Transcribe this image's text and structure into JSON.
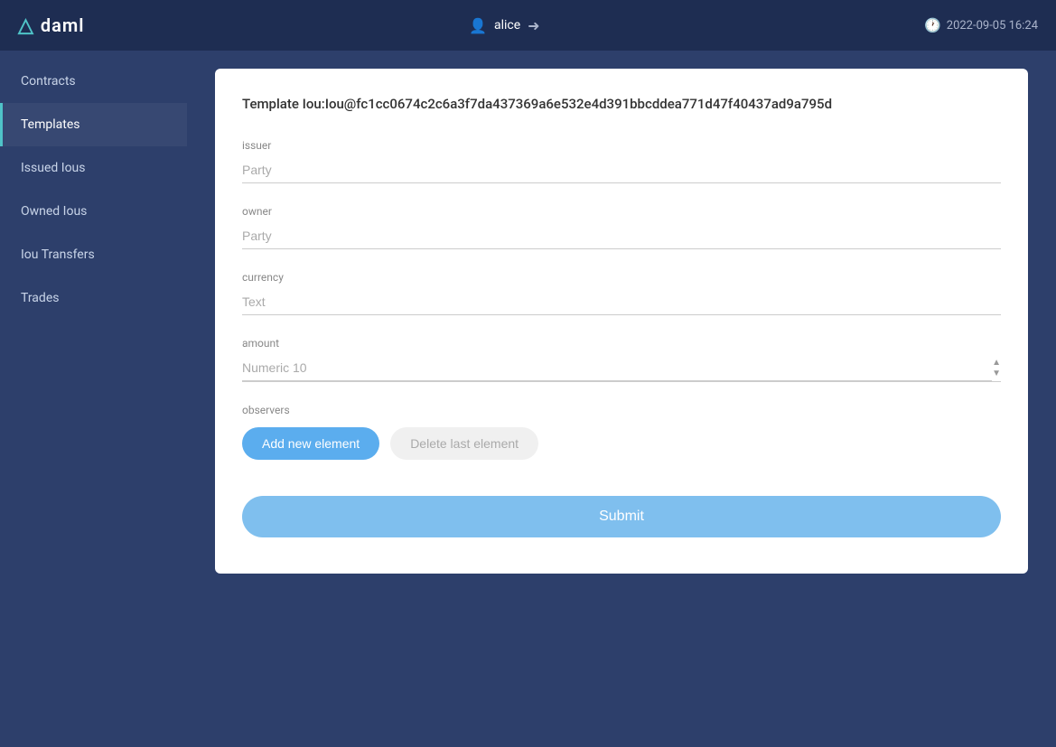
{
  "header": {
    "logo_icon": "▲",
    "logo_text": "daml",
    "user_name": "alice",
    "datetime": "2022-09-05 16:24"
  },
  "sidebar": {
    "items": [
      {
        "id": "contracts",
        "label": "Contracts",
        "active": false
      },
      {
        "id": "templates",
        "label": "Templates",
        "active": true
      },
      {
        "id": "issued-ious",
        "label": "Issued Ious",
        "active": false
      },
      {
        "id": "owned-ious",
        "label": "Owned Ious",
        "active": false
      },
      {
        "id": "iou-transfers",
        "label": "Iou Transfers",
        "active": false
      },
      {
        "id": "trades",
        "label": "Trades",
        "active": false
      }
    ]
  },
  "form": {
    "title": "Template Iou:Iou@fc1cc0674c2c6a3f7da437369a6e532e4d391bbcddea771d47f40437ad9a795d",
    "fields": {
      "issuer": {
        "label": "issuer",
        "placeholder": "Party"
      },
      "owner": {
        "label": "owner",
        "placeholder": "Party"
      },
      "currency": {
        "label": "currency",
        "placeholder": "Text"
      },
      "amount": {
        "label": "amount",
        "placeholder": "Numeric 10"
      },
      "observers": {
        "label": "observers",
        "add_button": "Add new element",
        "delete_button": "Delete last element"
      }
    },
    "submit_label": "Submit"
  }
}
